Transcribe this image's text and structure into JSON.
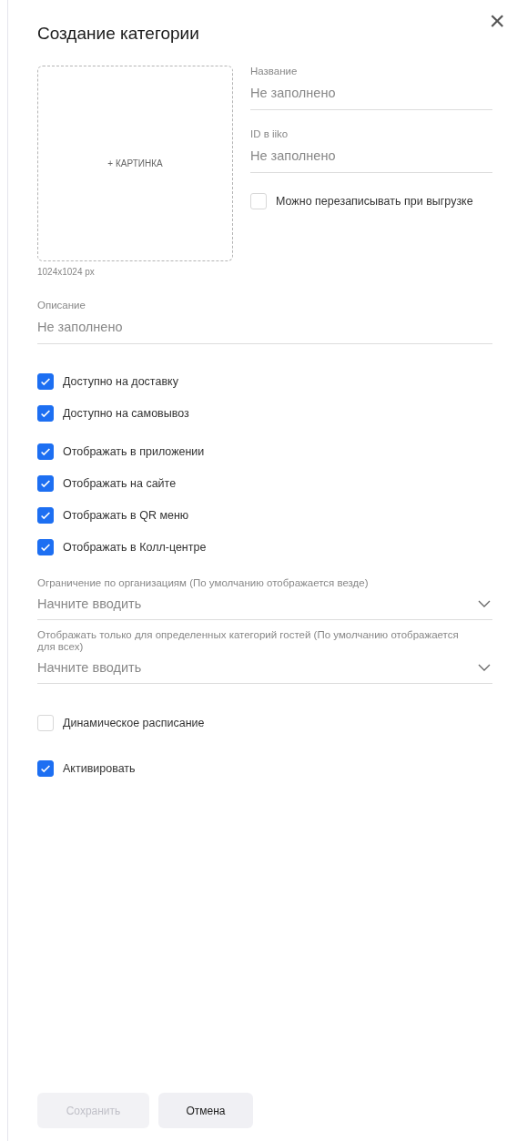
{
  "dialog": {
    "title": "Создание категории",
    "close": "×"
  },
  "image_upload": {
    "label": "+ КАРТИНКА",
    "size_hint": "1024x1024 px"
  },
  "fields": [
    {
      "label": "Название",
      "placeholder": "Не заполнено"
    },
    {
      "label": "ID в iiko",
      "placeholder": "Не заполнено"
    }
  ],
  "overwrite": {
    "label": "Можно перезаписывать при выгрузке",
    "checked": false
  },
  "description": {
    "label": "Описание",
    "placeholder": "Не заполнено"
  },
  "checkbox_groups": [
    [
      {
        "label": "Доступно на доставку",
        "checked": true
      },
      {
        "label": "Доступно на самовывоз",
        "checked": true
      }
    ],
    [
      {
        "label": "Отображать в приложении",
        "checked": true
      },
      {
        "label": "Отображать на сайте",
        "checked": true
      },
      {
        "label": "Отображать в QR меню",
        "checked": true
      },
      {
        "label": "Отображать в Колл-центре",
        "checked": true
      }
    ]
  ],
  "selects": [
    {
      "label": "Ограничение по организациям (По умолчанию отображается везде)",
      "placeholder": "Начните вводить"
    },
    {
      "label": "Отображать только для определенных категорий гостей (По умолчанию отображается для всех)",
      "placeholder": "Начните вводить"
    }
  ],
  "extra_checkboxes": [
    {
      "label": "Динамическое расписание",
      "checked": false
    },
    {
      "label": "Активировать",
      "checked": true
    }
  ],
  "buttons": [
    {
      "label": "Сохранить",
      "disabled": true
    },
    {
      "label": "Отмена",
      "disabled": false
    }
  ]
}
